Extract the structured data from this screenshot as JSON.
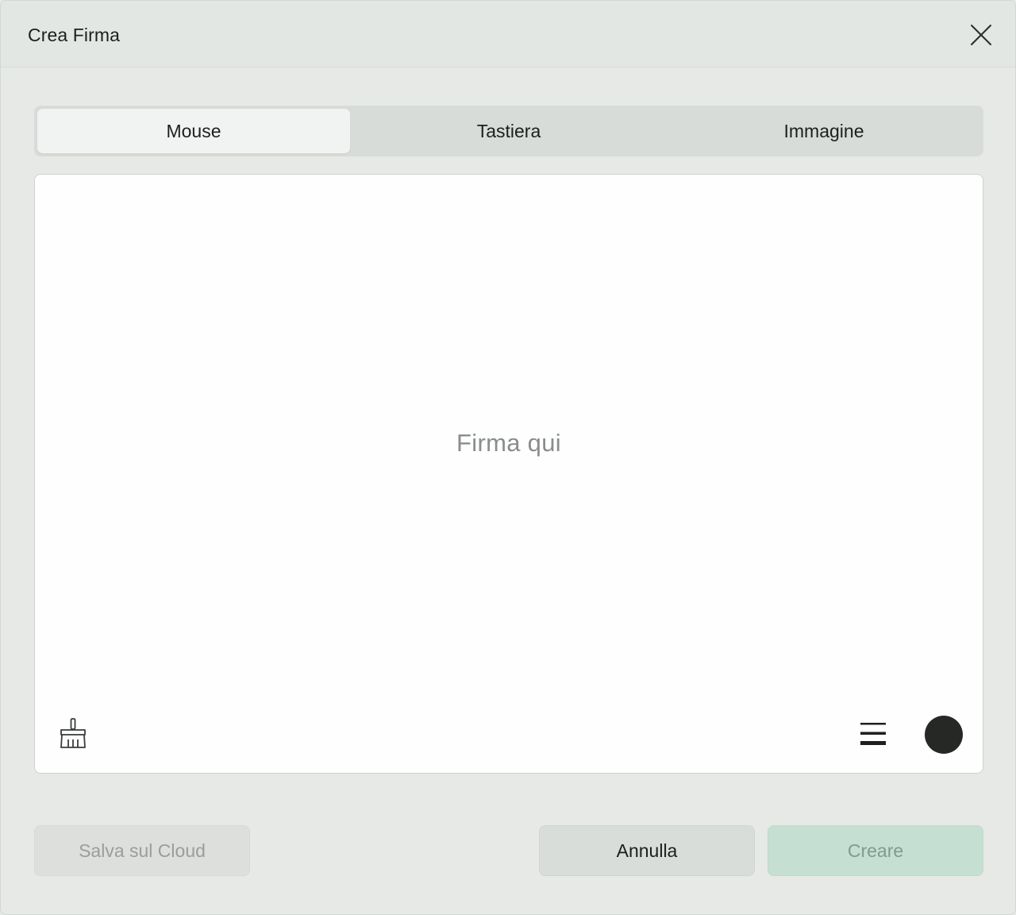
{
  "dialog": {
    "title": "Crea Firma",
    "close_icon": "close-icon"
  },
  "tabs": [
    {
      "label": "Mouse",
      "active": true
    },
    {
      "label": "Tastiera",
      "active": false
    },
    {
      "label": "Immagine",
      "active": false
    }
  ],
  "canvas": {
    "placeholder": "Firma qui",
    "tools": {
      "eraser_icon": "eraser-brush-icon",
      "thickness_icon": "line-thickness-icon",
      "pen_color": "#262826"
    }
  },
  "footer": {
    "save_cloud_label": "Salva sul Cloud",
    "cancel_label": "Annulla",
    "create_label": "Creare"
  },
  "colors": {
    "accent_disabled": "#c6dfd3",
    "background": "#e6e9e6",
    "canvas": "#fdfefd"
  }
}
